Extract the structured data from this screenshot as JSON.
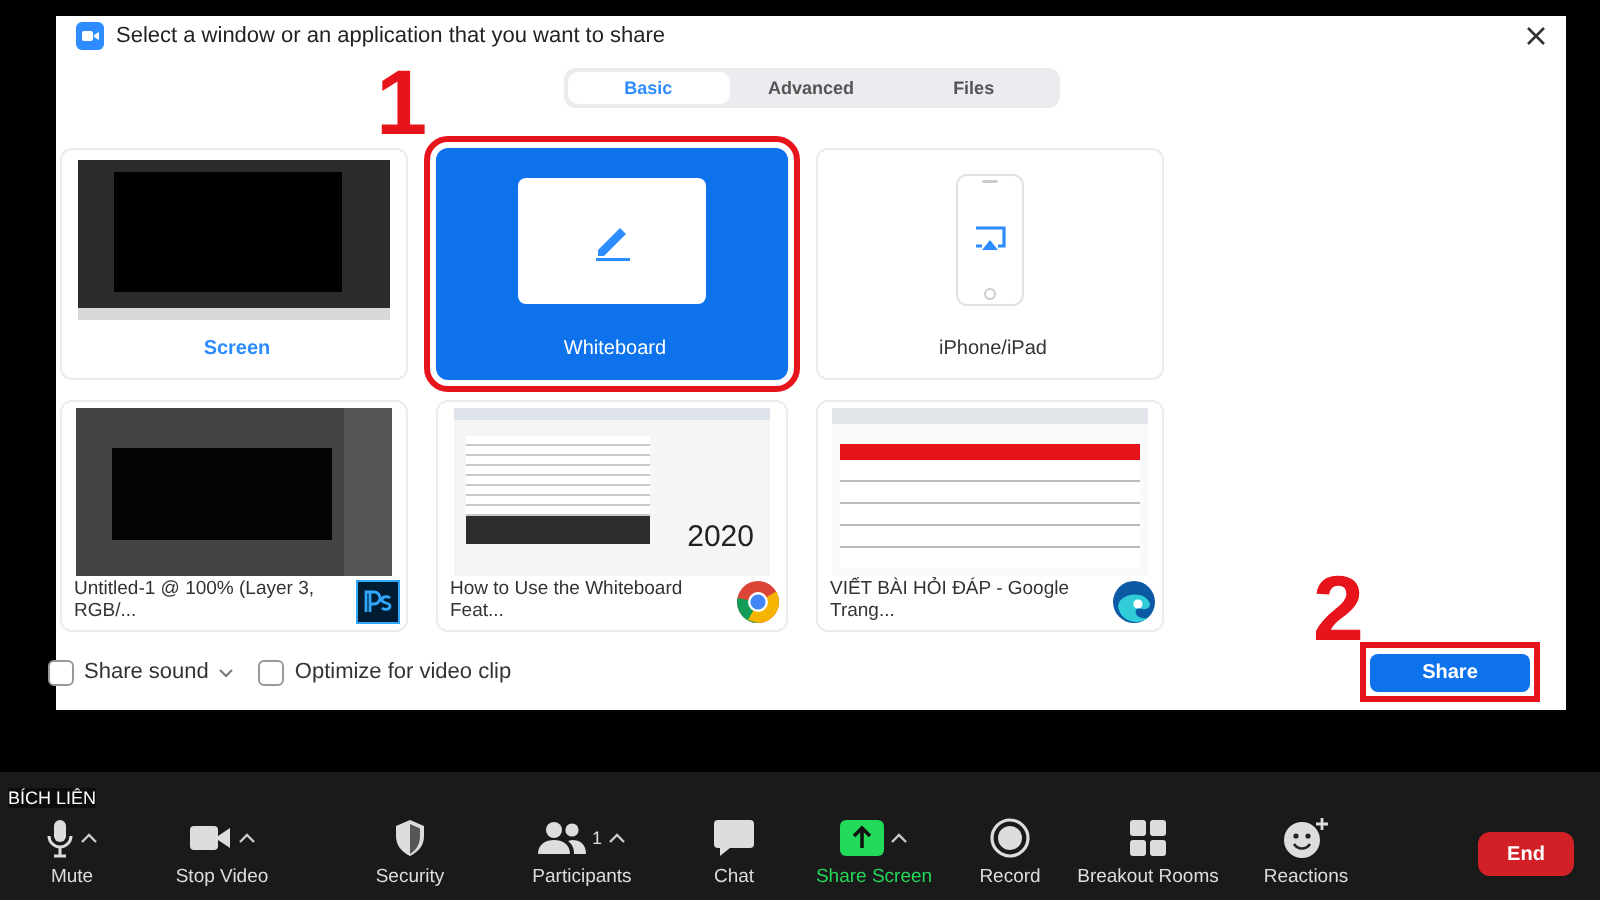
{
  "dialog": {
    "title": "Select a window or an application that you want to share"
  },
  "tabs": [
    {
      "label": "Basic",
      "selected": true
    },
    {
      "label": "Advanced",
      "selected": false
    },
    {
      "label": "Files",
      "selected": false
    }
  ],
  "tiles": [
    {
      "kind": "screen",
      "label": "Screen",
      "selected": false
    },
    {
      "kind": "whiteboard",
      "label": "Whiteboard",
      "selected": true
    },
    {
      "kind": "device",
      "label": "iPhone/iPad",
      "selected": false
    },
    {
      "kind": "photoshop_window",
      "label": "Untitled-1 @ 100% (Layer 3, RGB/...",
      "selected": false
    },
    {
      "kind": "chrome_window",
      "label": "How to Use the Whiteboard Feat...",
      "thumb_text": "2020",
      "selected": false
    },
    {
      "kind": "edge_window",
      "label": "VIẾT BÀI HỎI ĐÁP - Google Trang...",
      "selected": false
    }
  ],
  "options": [
    {
      "label": "Share sound",
      "checked": false,
      "caret": true
    },
    {
      "label": "Optimize for video clip",
      "checked": false,
      "caret": false
    }
  ],
  "share_button": "Share",
  "annotations": [
    "1",
    "2"
  ],
  "name_label": "BÍCH LIÊN",
  "toolbar": [
    {
      "kind": "mic",
      "label": "Mute",
      "caret": true,
      "highlight": false
    },
    {
      "kind": "camera",
      "label": "Stop Video",
      "caret": true,
      "highlight": false
    },
    {
      "kind": "shield",
      "label": "Security",
      "caret": false,
      "highlight": false
    },
    {
      "kind": "people",
      "label": "Participants",
      "count": "1",
      "caret": true,
      "highlight": false
    },
    {
      "kind": "chat",
      "label": "Chat",
      "caret": false,
      "highlight": false
    },
    {
      "kind": "share",
      "label": "Share Screen",
      "caret": true,
      "highlight": true
    },
    {
      "kind": "record",
      "label": "Record",
      "caret": false,
      "highlight": false
    },
    {
      "kind": "grid",
      "label": "Breakout Rooms",
      "caret": false,
      "highlight": false
    },
    {
      "kind": "smile",
      "label": "Reactions",
      "caret": false,
      "highlight": false
    }
  ],
  "end_button": "End"
}
